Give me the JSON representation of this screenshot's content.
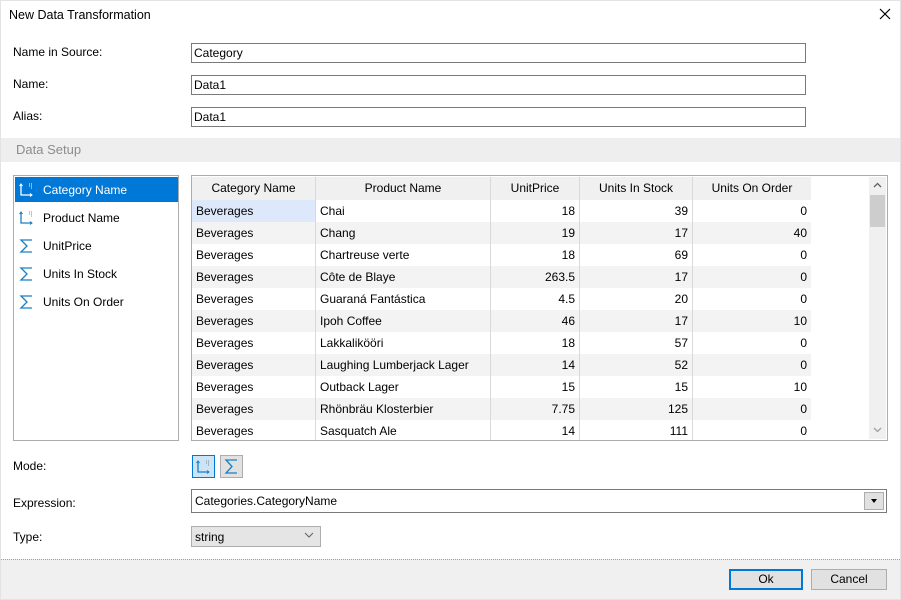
{
  "window": {
    "title": "New Data Transformation",
    "close_icon": "close-icon"
  },
  "fields": {
    "name_in_source": {
      "label": "Name in Source:",
      "value": "Category"
    },
    "name": {
      "label": "Name:",
      "value": "Data1"
    },
    "alias": {
      "label": "Alias:",
      "value": "Data1"
    }
  },
  "section": {
    "title": "Data Setup"
  },
  "columns_list": {
    "items": [
      {
        "label": "Category Name",
        "icon": "dimension-icon",
        "selected": true
      },
      {
        "label": "Product Name",
        "icon": "dimension-icon",
        "selected": false
      },
      {
        "label": "UnitPrice",
        "icon": "sigma-icon",
        "selected": false
      },
      {
        "label": "Units In Stock",
        "icon": "sigma-icon",
        "selected": false
      },
      {
        "label": "Units On Order",
        "icon": "sigma-icon",
        "selected": false
      }
    ]
  },
  "grid": {
    "headers": [
      "Category Name",
      "Product Name",
      "UnitPrice",
      "Units In Stock",
      "Units On Order"
    ],
    "rows": [
      [
        "Beverages",
        "Chai",
        "18",
        "39",
        "0"
      ],
      [
        "Beverages",
        "Chang",
        "19",
        "17",
        "40"
      ],
      [
        "Beverages",
        "Chartreuse verte",
        "18",
        "69",
        "0"
      ],
      [
        "Beverages",
        "Côte de Blaye",
        "263.5",
        "17",
        "0"
      ],
      [
        "Beverages",
        "Guaraná Fantástica",
        "4.5",
        "20",
        "0"
      ],
      [
        "Beverages",
        "Ipoh Coffee",
        "46",
        "17",
        "10"
      ],
      [
        "Beverages",
        "Lakkalikööri",
        "18",
        "57",
        "0"
      ],
      [
        "Beverages",
        "Laughing Lumberjack Lager",
        "14",
        "52",
        "0"
      ],
      [
        "Beverages",
        "Outback Lager",
        "15",
        "15",
        "10"
      ],
      [
        "Beverages",
        "Rhönbräu Klosterbier",
        "7.75",
        "125",
        "0"
      ],
      [
        "Beverages",
        "Sasquatch Ale",
        "14",
        "111",
        "0"
      ]
    ],
    "scroll_up_glyph": "^",
    "scroll_down_glyph": "v"
  },
  "mode": {
    "label": "Mode:",
    "options": [
      {
        "name": "dimension",
        "icon": "dimension-icon",
        "active": true
      },
      {
        "name": "measure",
        "icon": "sigma-icon",
        "active": false
      }
    ]
  },
  "expression": {
    "label": "Expression:",
    "value": "Categories.CategoryName"
  },
  "type": {
    "label": "Type:",
    "value": "string"
  },
  "buttons": {
    "ok": "Ok",
    "cancel": "Cancel"
  },
  "colors": {
    "accent": "#0078d7",
    "sigma": "#1a7fc1",
    "focus_cell": "#dde9fa"
  }
}
